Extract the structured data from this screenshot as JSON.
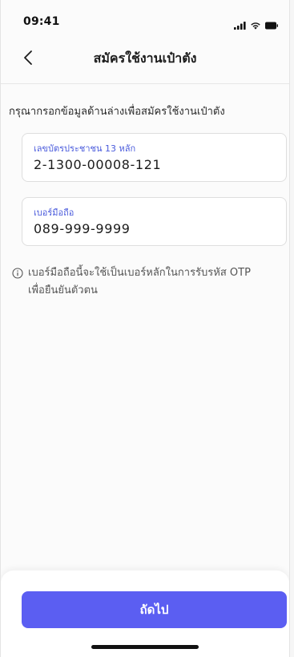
{
  "status_bar": {
    "time": "09:41",
    "icons": [
      "signal-icon",
      "wifi-icon",
      "battery-icon"
    ]
  },
  "header": {
    "back_icon": "chevron-left-icon",
    "title": "สมัครใช้งานเป๋าตัง"
  },
  "instruction": "กรุณากรอกข้อมูลด้านล่างเพื่อสมัครใช้งานเป๋าตัง",
  "fields": [
    {
      "label": "เลขบัตรประชาชน 13 หลัก",
      "value": "2-1300-00008-121"
    },
    {
      "label": "เบอร์มือถือ",
      "value": "089-999-9999"
    }
  ],
  "info_note": {
    "icon": "info-icon",
    "line1": "เบอร์มือถือนี้จะใช้เป็นเบอร์หลักในการรับรหัส OTP",
    "line2": "เพื่อยืนยันตัวตน"
  },
  "footer": {
    "next_label": "ถัดไป"
  },
  "colors": {
    "accent": "#5b5ef2",
    "label": "#4a5bdc"
  }
}
